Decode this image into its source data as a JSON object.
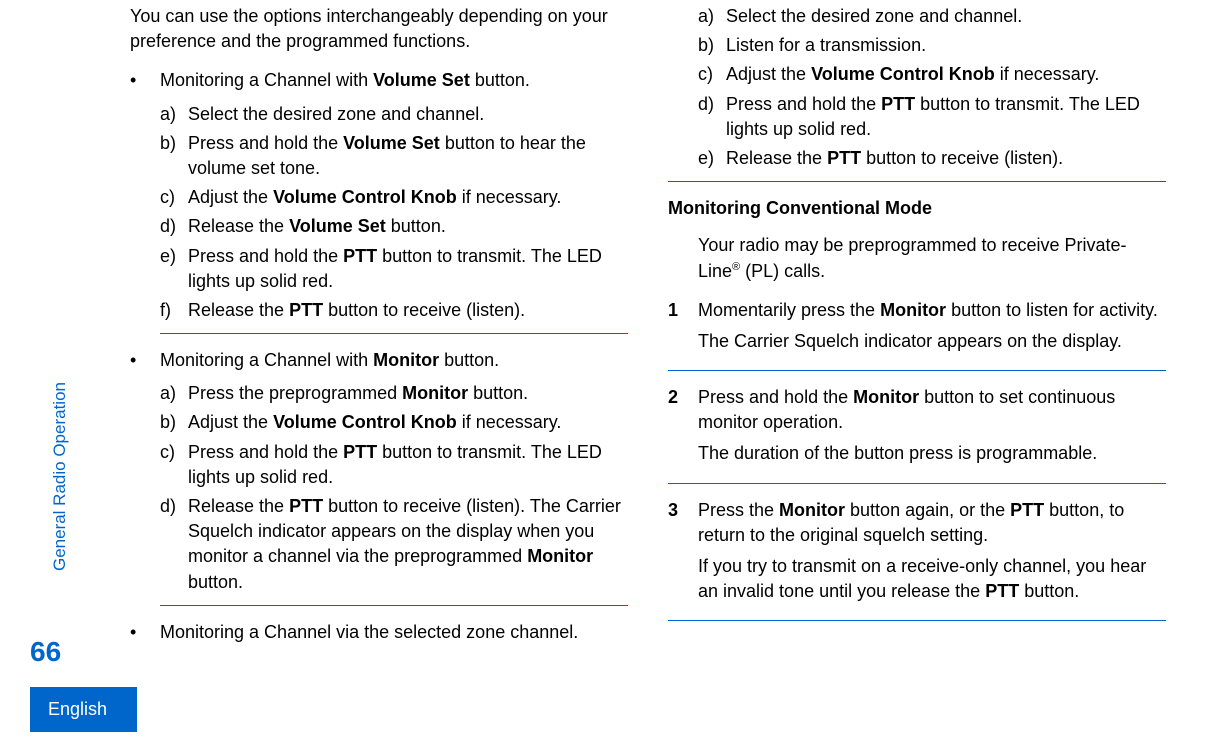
{
  "sidebar": {
    "section_label": "General Radio Operation",
    "page_number": "66",
    "language": "English"
  },
  "col1": {
    "intro": "You can use the options interchangeably depending on your preference and the programmed functions.",
    "bullet1": {
      "prefix": "Monitoring a Channel with ",
      "bold": "Volume Set",
      "suffix": " button.",
      "a": "Select the desired zone and channel.",
      "b_prefix": "Press and hold the ",
      "b_bold": "Volume Set",
      "b_suffix": " button to hear the volume set tone.",
      "c_prefix": "Adjust the ",
      "c_bold": "Volume Control Knob",
      "c_suffix": " if necessary.",
      "d_prefix": "Release the ",
      "d_bold": "Volume Set",
      "d_suffix": " button.",
      "e_prefix": "Press and hold the ",
      "e_bold": "PTT",
      "e_suffix": " button to transmit. The LED lights up solid red.",
      "f_prefix": "Release the ",
      "f_bold": "PTT",
      "f_suffix": " button to receive (listen)."
    },
    "bullet2": {
      "prefix": "Monitoring a Channel with ",
      "bold": "Monitor",
      "suffix": " button.",
      "a_prefix": "Press the preprogrammed ",
      "a_bold": "Monitor",
      "a_suffix": " button.",
      "b_prefix": "Adjust the ",
      "b_bold": "Volume Control Knob",
      "b_suffix": " if necessary.",
      "c_prefix": "Press and hold the ",
      "c_bold": "PTT",
      "c_suffix": " button to transmit. The LED lights up solid red.",
      "d_prefix": "Release the ",
      "d_bold": "PTT",
      "d_suffix": " button to receive (listen). The Carrier Squelch indicator appears on the display when you monitor a channel via the preprogrammed ",
      "d_bold2": "Monitor",
      "d_suffix2": " button."
    },
    "bullet3": {
      "text": "Monitoring a Channel via the selected zone channel."
    }
  },
  "col2": {
    "list1": {
      "a": "Select the desired zone and channel.",
      "b": "Listen for a transmission.",
      "c_prefix": "Adjust the ",
      "c_bold": "Volume Control Knob",
      "c_suffix": " if necessary.",
      "d_prefix": "Press and hold the ",
      "d_bold": "PTT",
      "d_suffix": " button to transmit. The LED lights up solid red.",
      "e_prefix": "Release the ",
      "e_bold": "PTT",
      "e_suffix": " button to receive (listen)."
    },
    "subheading": "Monitoring Conventional Mode",
    "para1_prefix": "Your radio may be preprogrammed to receive Private-Line",
    "para1_sup": "®",
    "para1_suffix": " (PL) calls.",
    "num1": {
      "p1_prefix": "Momentarily press the ",
      "p1_bold": "Monitor",
      "p1_suffix": " button to listen for activity.",
      "p2": "The Carrier Squelch indicator appears on the display."
    },
    "num2": {
      "p1_prefix": "Press and hold the ",
      "p1_bold": "Monitor",
      "p1_suffix": " button to set continuous monitor operation.",
      "p2": "The duration of the button press is programmable."
    },
    "num3": {
      "p1_prefix": "Press the ",
      "p1_bold": "Monitor",
      "p1_mid": " button again, or the ",
      "p1_bold2": "PTT",
      "p1_suffix": " button, to return to the original squelch setting.",
      "p2_prefix": "If you try to transmit on a receive-only channel, you hear an invalid tone until you release the ",
      "p2_bold": "PTT",
      "p2_suffix": " button."
    }
  }
}
